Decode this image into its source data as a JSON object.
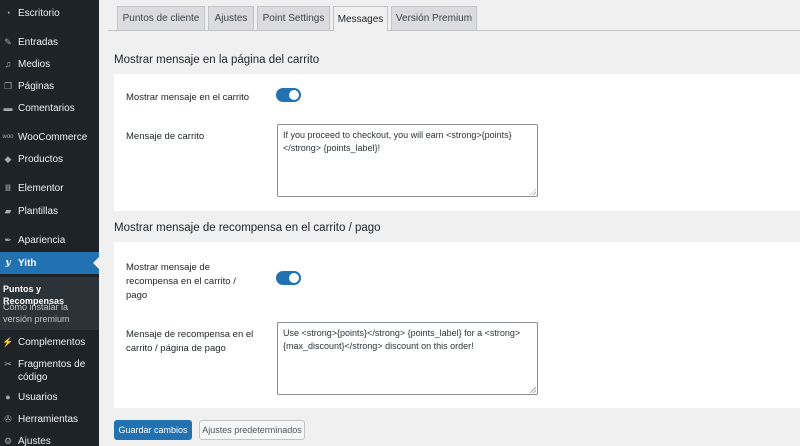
{
  "sidebar": {
    "items": [
      {
        "label": "Escritorio",
        "icon": "dashboard-icon"
      },
      {
        "label": "Entradas",
        "icon": "pushpin-icon"
      },
      {
        "label": "Medios",
        "icon": "media-icon"
      },
      {
        "label": "Páginas",
        "icon": "pages-icon"
      },
      {
        "label": "Comentarios",
        "icon": "comments-icon"
      },
      {
        "label": "WooCommerce",
        "icon": "woocommerce-icon"
      },
      {
        "label": "Productos",
        "icon": "products-icon"
      },
      {
        "label": "Elementor",
        "icon": "elementor-icon"
      },
      {
        "label": "Plantillas",
        "icon": "templates-icon"
      },
      {
        "label": "Apariencia",
        "icon": "appearance-icon"
      },
      {
        "label": "Yith",
        "icon": "yith-icon"
      },
      {
        "label": "Complementos",
        "icon": "plugins-icon"
      },
      {
        "label": "Fragmentos de código",
        "icon": "code-snippets-icon"
      },
      {
        "label": "Usuarios",
        "icon": "users-icon"
      },
      {
        "label": "Herramientas",
        "icon": "tools-icon"
      },
      {
        "label": "Ajustes",
        "icon": "settings-icon"
      }
    ],
    "submenu": [
      {
        "label": "Puntos y Recompensas"
      },
      {
        "label": "Cómo instalar la versión premium"
      }
    ]
  },
  "tabs": [
    {
      "label": "Puntos de cliente"
    },
    {
      "label": "Ajustes"
    },
    {
      "label": "Point Settings"
    },
    {
      "label": "Messages"
    },
    {
      "label": "Versión Premium"
    }
  ],
  "sections": [
    {
      "title": "Mostrar mensaje en la página del carrito",
      "toggle_label": "Mostrar mensaje en el carrito",
      "toggle_on": true,
      "textarea_label": "Mensaje de carrito",
      "textarea_value": "If you proceed to checkout, you will earn <strong>{points}</strong> {points_label}!"
    },
    {
      "title": "Mostrar mensaje de recompensa en el carrito / pago",
      "toggle_label": "Mostrar mensaje de recompensa en el carrito / pago",
      "toggle_on": true,
      "textarea_label": "Mensaje de recompensa en el carrito / página de pago",
      "textarea_value": "Use <strong>{points}</strong> {points_label} for a <strong>{max_discount}</strong> discount on this order!"
    }
  ],
  "buttons": {
    "save_label": "Guardar cambios",
    "defaults_label": "Ajustes predeterminados"
  },
  "colors": {
    "sidebar_bg": "#1d2327",
    "accent": "#2271b1",
    "page_bg": "#f0f0f1"
  }
}
